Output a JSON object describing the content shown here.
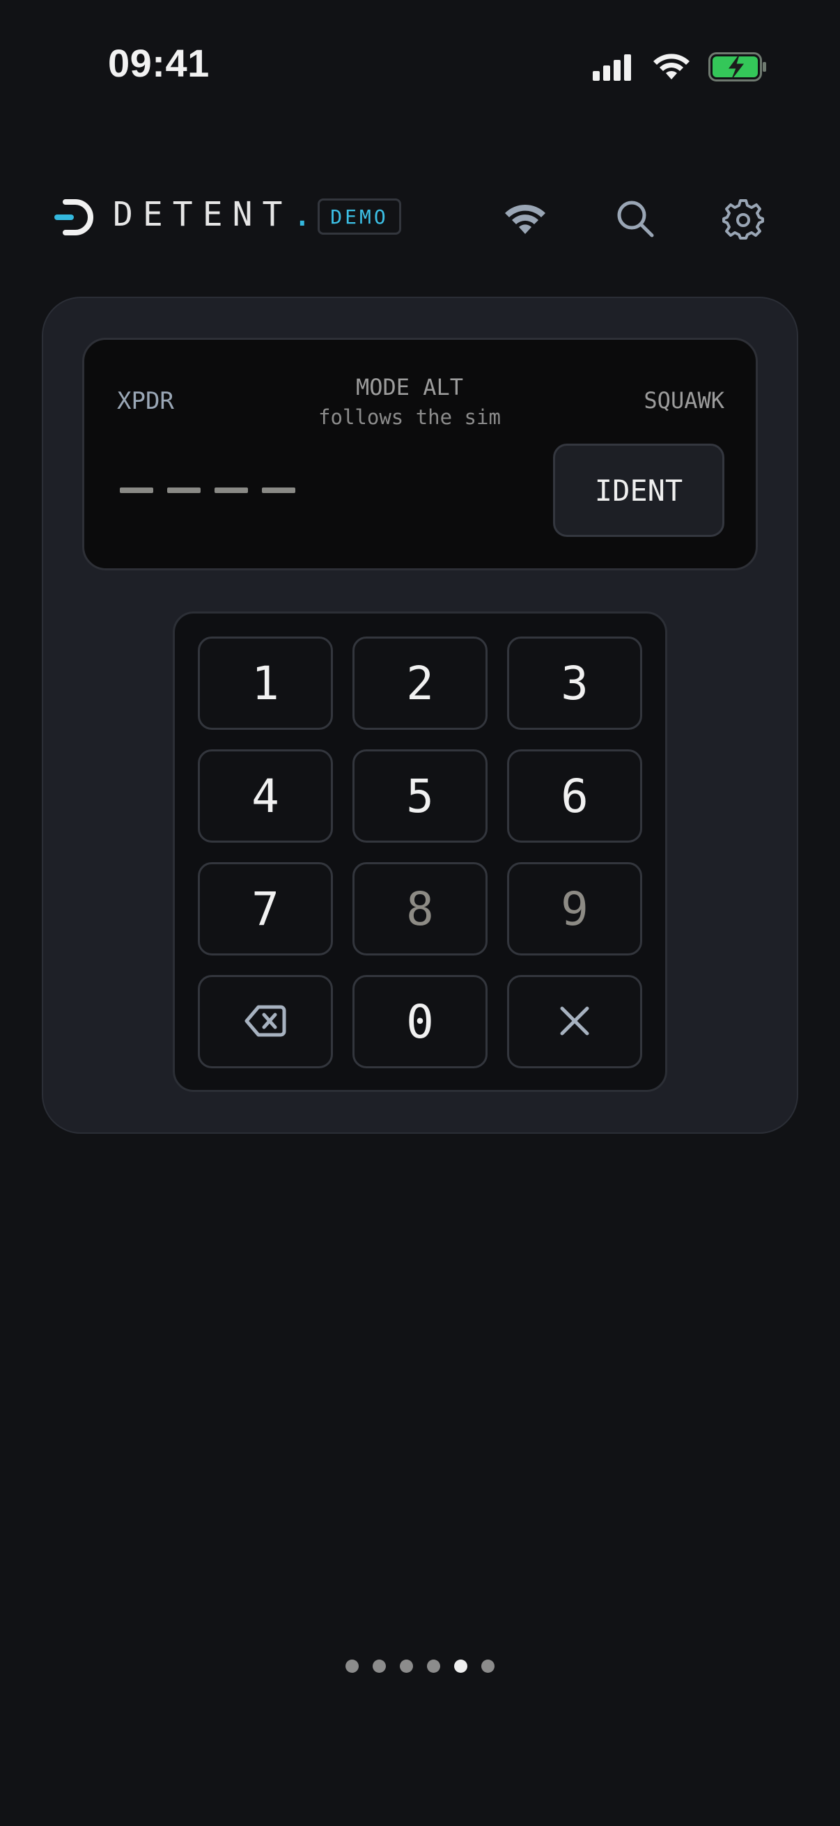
{
  "status_bar": {
    "time": "09:41",
    "icons": [
      "cellular-signal-icon",
      "wifi-icon",
      "battery-charging-icon"
    ],
    "battery_color": "#34c759"
  },
  "header": {
    "brand_name": "DETENT",
    "brand_dot": ".",
    "badge": "DEMO",
    "icons": [
      "connection-wifi-icon",
      "search-icon",
      "settings-gear-icon"
    ],
    "accent_color": "#34b8de"
  },
  "transponder": {
    "left_label": "XPDR",
    "mode_label": "MODE ALT",
    "mode_sub": "follows the sim",
    "right_label": "SQUAWK",
    "code_placeholder": [
      "—",
      "—",
      "—",
      "—"
    ],
    "ident_label": "IDENT"
  },
  "keypad": {
    "keys": [
      {
        "label": "1",
        "enabled": true
      },
      {
        "label": "2",
        "enabled": true
      },
      {
        "label": "3",
        "enabled": true
      },
      {
        "label": "4",
        "enabled": true
      },
      {
        "label": "5",
        "enabled": true
      },
      {
        "label": "6",
        "enabled": true
      },
      {
        "label": "7",
        "enabled": true
      },
      {
        "label": "8",
        "enabled": false
      },
      {
        "label": "9",
        "enabled": false
      },
      {
        "label": "",
        "icon": "backspace-icon",
        "enabled": true
      },
      {
        "label": "0",
        "enabled": true
      },
      {
        "label": "",
        "icon": "clear-x-icon",
        "enabled": true
      }
    ]
  },
  "pager": {
    "count": 6,
    "active_index": 4
  }
}
